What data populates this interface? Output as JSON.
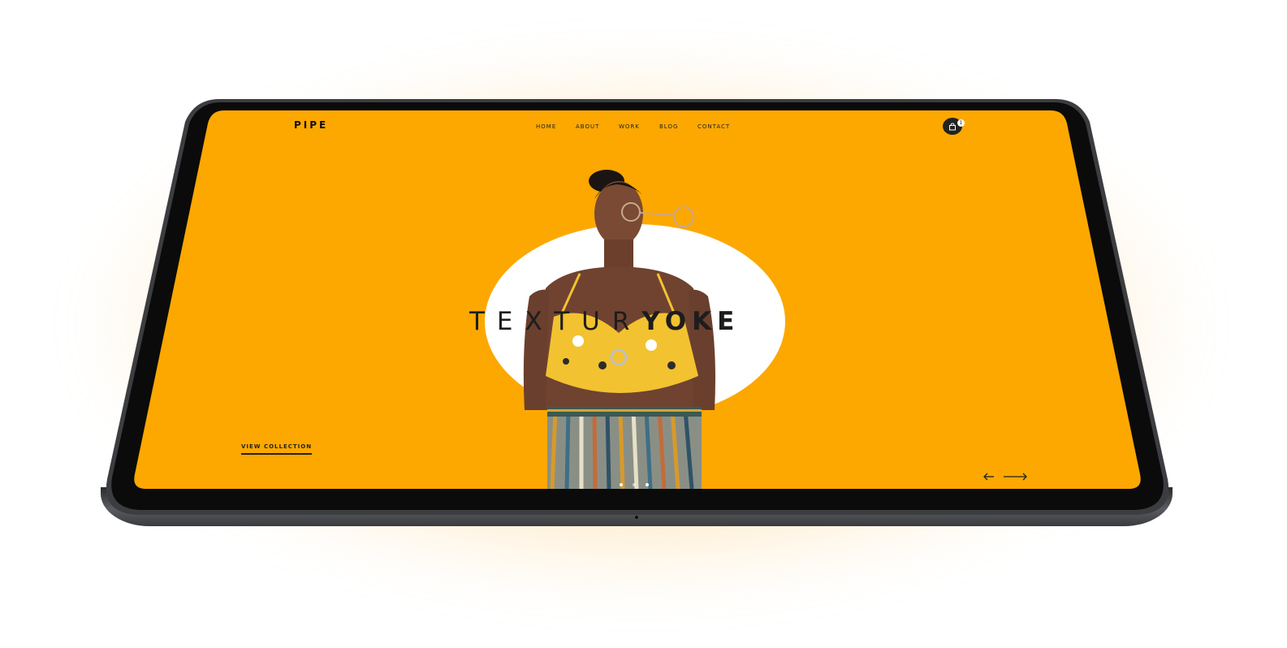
{
  "brand": {
    "logo": "PIPE"
  },
  "nav": {
    "items": [
      {
        "label": "HOME"
      },
      {
        "label": "ABOUT"
      },
      {
        "label": "WORK"
      },
      {
        "label": "BLOG"
      },
      {
        "label": "CONTACT"
      }
    ]
  },
  "cart": {
    "count": "1",
    "icon": "shopping-bag-icon"
  },
  "hero": {
    "title_light": "TEXTUR",
    "title_bold": "YOKE",
    "cta_label": "VIEW COLLECTION",
    "prev_icon": "arrow-left-icon",
    "next_icon": "arrow-right-icon",
    "slide_count": 3,
    "active_slide": 1
  },
  "colors": {
    "screen_bg": "#fca800",
    "hero_circle": "#ffffff",
    "text": "#1d1d1d",
    "bezel": "#0b0b0c",
    "frame": "#5a5c61"
  }
}
